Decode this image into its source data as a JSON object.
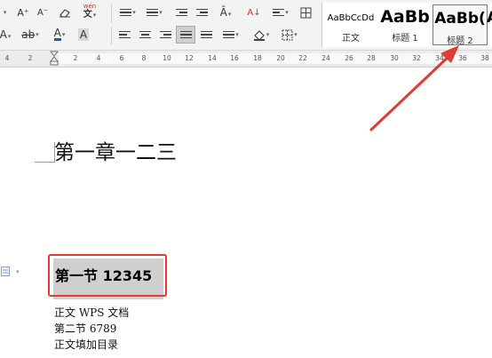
{
  "toolbar": {
    "row1": {
      "font_grow": "A⁺",
      "font_shrink": "A⁻",
      "pinyin_guide": "wén",
      "sort": "A↓"
    },
    "row2": {
      "font_color_letter": "A",
      "char_shading_letter": "A",
      "strikethrough_letters": "ab",
      "format_letter": "A"
    }
  },
  "styles_gallery": {
    "items": [
      {
        "preview": "AaBbCcDd",
        "label": "正文"
      },
      {
        "preview": "AaBb",
        "label": "标题 1"
      },
      {
        "preview": "AaBb(",
        "label": "标题 2",
        "selected": true
      },
      {
        "preview": "A",
        "label": ""
      }
    ]
  },
  "ruler": {
    "ticks": [
      "4",
      "2",
      "2",
      "4",
      "6",
      "8",
      "10",
      "12",
      "14",
      "16",
      "18",
      "20",
      "22",
      "24",
      "26",
      "28",
      "30",
      "32",
      "34",
      "36",
      "38"
    ]
  },
  "document": {
    "chapter_heading": "第一章一二三",
    "section_heading": "第一节 12345",
    "lines": [
      "正文 WPS 文档",
      "第二节 6789",
      "正文填加目录"
    ]
  },
  "colors": {
    "highlight_box": "#e33a32",
    "arrow": "#e33a32",
    "font_color_underline": "#1a55d6"
  }
}
